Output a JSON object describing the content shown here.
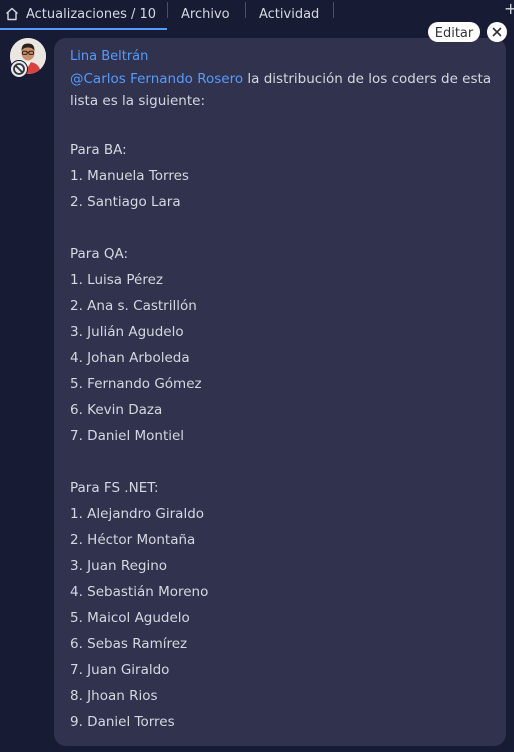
{
  "tabs": [
    {
      "label": "Actualizaciones / 10",
      "active": true
    },
    {
      "label": "Archivo",
      "active": false
    },
    {
      "label": "Actividad",
      "active": false
    }
  ],
  "tab_add_symbol": "+",
  "update": {
    "author": "Lina Beltrán",
    "mention": "@Carlos Fernando Rosero",
    "intro_text": " la distribución de los coders de esta lista es la siguiente:",
    "edit_label": "Editar",
    "groups": [
      {
        "title": "Para BA:",
        "items": [
          "1. Manuela Torres",
          "2. Santiago Lara"
        ]
      },
      {
        "title": "Para QA:",
        "items": [
          "1. Luisa Pérez",
          "2. Ana s. Castrillón",
          "3. Julián Agudelo",
          "4. Johan Arboleda",
          "5. Fernando Gómez",
          "6. Kevin Daza",
          "7. Daniel Montiel"
        ]
      },
      {
        "title": "Para FS .NET:",
        "items": [
          "1. Alejandro Giraldo",
          "2. Héctor Montaña",
          "3. Juan Regino",
          "4. Sebastián Moreno",
          "5. Maicol Agudelo",
          "6. Sebas Ramírez",
          "7. Juan Giraldo",
          "8. Jhoan Rios",
          "9. Daniel Torres"
        ]
      }
    ]
  },
  "colors": {
    "background": "#181b34",
    "card": "#30324e",
    "accent": "#579bfc",
    "text": "#d5d8df"
  }
}
